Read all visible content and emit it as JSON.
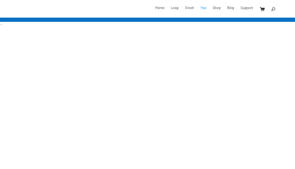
{
  "nav": {
    "items": [
      {
        "label": "Home",
        "active": false
      },
      {
        "label": "Leap",
        "active": false
      },
      {
        "label": "Fresh",
        "active": false
      },
      {
        "label": "Yep",
        "active": true
      },
      {
        "label": "Shop",
        "active": false
      },
      {
        "label": "Blog",
        "active": false
      },
      {
        "label": "Support",
        "active": false
      }
    ],
    "cart_icon": "shopping-cart-icon",
    "search_icon": "search-icon"
  },
  "banner": {
    "color": "#0c71c3"
  },
  "accent_color": "#2ea3f2",
  "marker": {
    "text": "•"
  }
}
